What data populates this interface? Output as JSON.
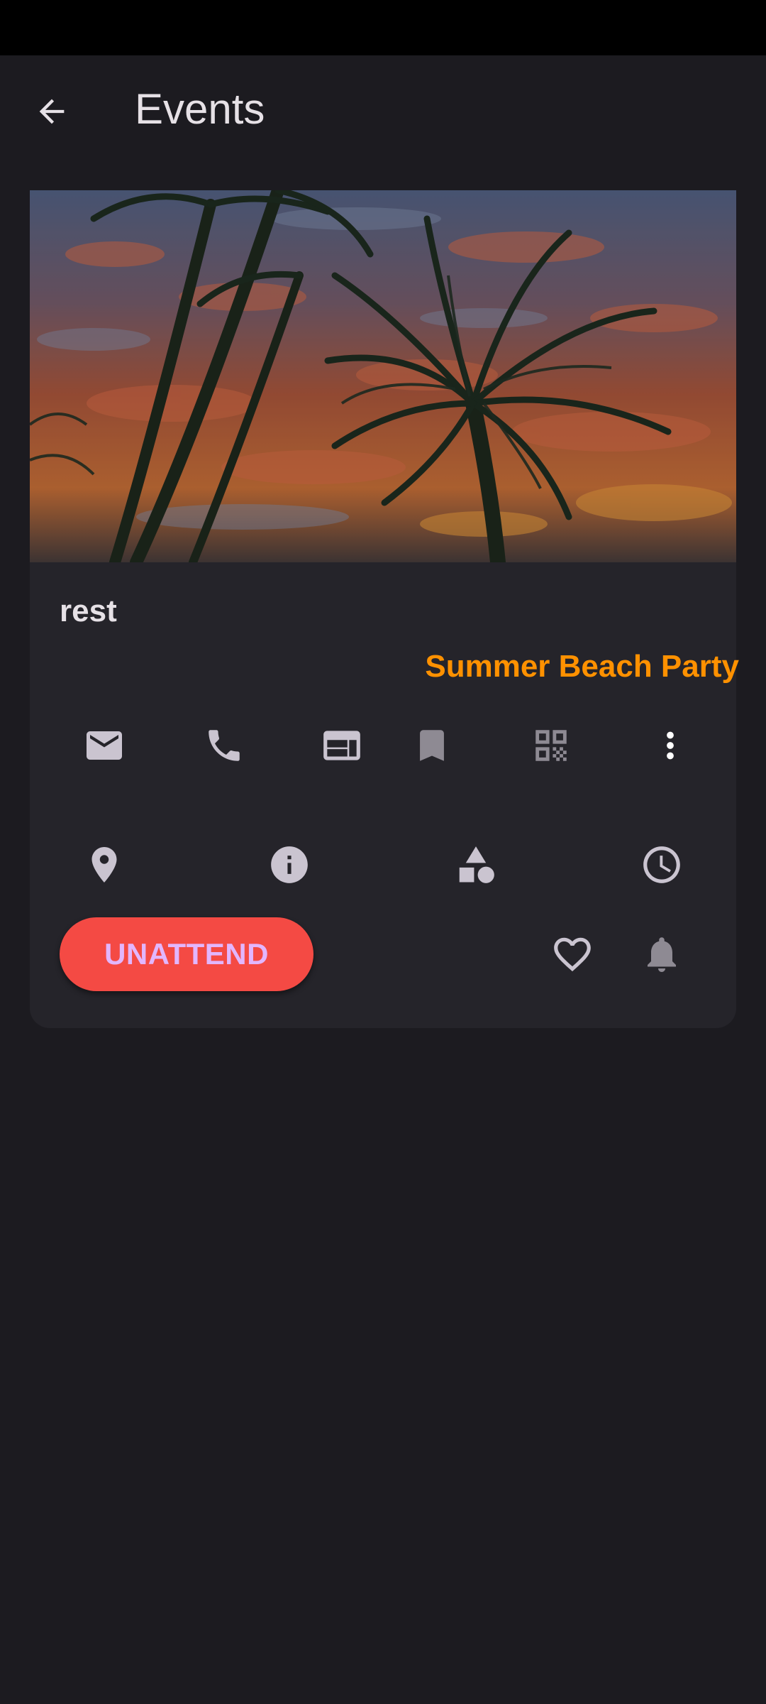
{
  "app_bar": {
    "title": "Events"
  },
  "event": {
    "name": "rest",
    "subtitle": "Summer Beach Party",
    "action_label": "UNATTEND",
    "image_subject": "palm trees against sunset sky"
  },
  "icons": {
    "row1": [
      "email-icon",
      "phone-icon",
      "web-icon",
      "bookmark-icon",
      "qr-code-icon",
      "more-vert-icon"
    ],
    "row2": [
      "location-icon",
      "info-icon",
      "category-icon",
      "clock-icon"
    ],
    "row3": [
      "heart-icon",
      "bell-icon"
    ]
  },
  "colors": {
    "background": "#1c1b20",
    "card": "#25242a",
    "accent_orange": "#ff9100",
    "attend_button": "#f44a44",
    "attend_text": "#e2b6ff"
  }
}
